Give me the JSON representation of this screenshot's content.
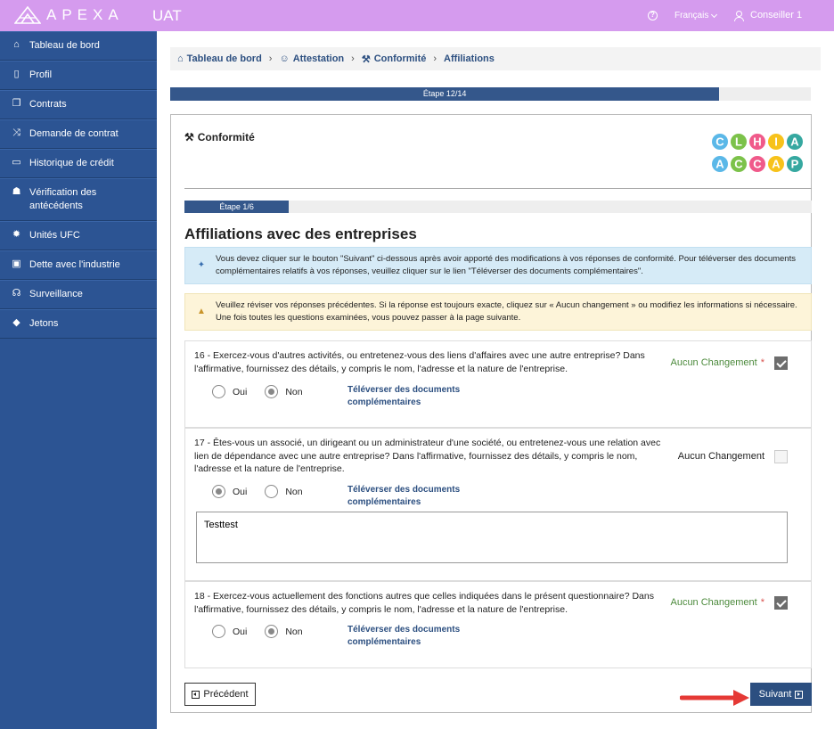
{
  "header": {
    "logo_text": "APEXA",
    "environment": "UAT",
    "language": "Français",
    "user": "Conseiller 1",
    "help_icon": "help-circle-icon"
  },
  "sidebar": {
    "items": [
      {
        "label": "Tableau de bord",
        "icon": "home-icon"
      },
      {
        "label": "Profil",
        "icon": "profile-icon"
      },
      {
        "label": "Contrats",
        "icon": "contracts-icon"
      },
      {
        "label": "Demande de contrat",
        "icon": "shuffle-icon"
      },
      {
        "label": "Historique de crédit",
        "icon": "credit-card-icon"
      },
      {
        "label": "Vérification des antécédents",
        "icon": "user-secret-icon"
      },
      {
        "label": "Unités UFC",
        "icon": "gear-icon"
      },
      {
        "label": "Dette avec l'industrie",
        "icon": "money-icon"
      },
      {
        "label": "Surveillance",
        "icon": "binoculars-icon"
      },
      {
        "label": "Jetons",
        "icon": "tag-icon"
      }
    ]
  },
  "breadcrumb": {
    "items": [
      "Tableau de bord",
      "Attestation",
      "Conformité",
      "Affiliations"
    ]
  },
  "progress": {
    "label": "Étape 12/14",
    "fraction": 0.8571
  },
  "card": {
    "title": "Conformité",
    "logo_top": "CLHIA",
    "logo_bottom": "ACCAP",
    "sub_progress": {
      "label": "Étape 1/6",
      "fraction": 0.1667
    },
    "section_title": "Affiliations avec des entreprises",
    "info_alert": "Vous devez cliquer sur le bouton \"Suivant\" ci-dessous après avoir apporté des modifications à vos réponses de conformité. Pour téléverser des documents complémentaires relatifs à vos réponses, veuillez cliquer sur le lien \"Téléverser des documents complémentaires\".",
    "warn_alert": "Veuillez réviser vos réponses précédentes. Si la réponse est toujours exacte, cliquez sur « Aucun changement » ou modifiez les informations si nécessaire. Une fois toutes les questions examinées, vous pouvez passer à la page suivante.",
    "questions": [
      {
        "text": "16 - Exercez-vous d'autres activités, ou entretenez-vous des liens d'affaires avec une autre entreprise? Dans l'affirmative, fournissez des détails, y compris le nom, l'adresse et la nature de l'entreprise.",
        "no_change_label": "Aucun Changement",
        "required_mark": "*",
        "no_change_checked": true,
        "oui_label": "Oui",
        "non_label": "Non",
        "selected": "Non",
        "upload_label": "Téléverser des documents complémentaires"
      },
      {
        "text": "17 - Êtes-vous un associé, un dirigeant ou un administrateur d'une société, ou entretenez-vous une relation avec lien de dépendance avec une autre entreprise? Dans l'affirmative, fournissez des détails, y compris le nom, l'adresse et la nature de l'entreprise.",
        "no_change_label": "Aucun Changement",
        "no_change_checked": false,
        "oui_label": "Oui",
        "non_label": "Non",
        "selected": "Oui",
        "upload_label": "Téléverser des documents complémentaires",
        "details_value": "Testtest"
      },
      {
        "text": "18 - Exercez-vous actuellement des fonctions autres que celles indiquées dans le présent questionnaire? Dans l'affirmative, fournissez des détails, y compris le nom, l'adresse et la nature de l'entreprise.",
        "no_change_label": "Aucun Changement",
        "required_mark": "*",
        "no_change_checked": true,
        "oui_label": "Oui",
        "non_label": "Non",
        "selected": "Non",
        "upload_label": "Téléverser des documents complémentaires"
      }
    ],
    "prev_button": "Précédent",
    "next_button": "Suivant"
  },
  "colors": {
    "topbar": "#d59bee",
    "sidebar": "#2c5493",
    "primary": "#2c4f80",
    "arrow": "#e53935"
  }
}
